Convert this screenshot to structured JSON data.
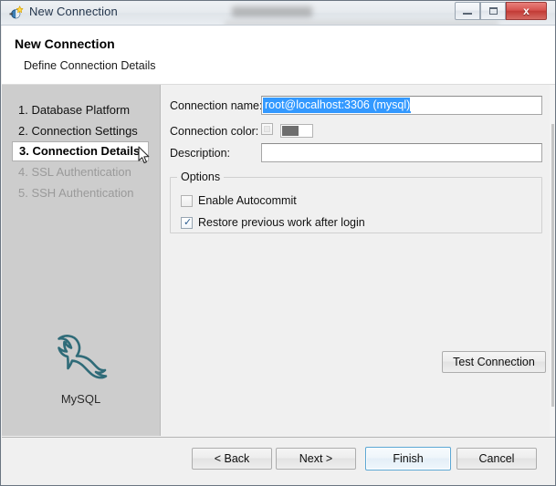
{
  "window": {
    "title": "New Connection",
    "icon": "connection-plug-icon",
    "controls": {
      "minimize": "Minimize",
      "maximize": "Maximize",
      "close": "Close",
      "close_glyph": "x"
    }
  },
  "header": {
    "title": "New Connection",
    "subtitle": "Define Connection Details"
  },
  "sidebar": {
    "steps": [
      {
        "label": "1. Database Platform",
        "state": "done"
      },
      {
        "label": "2. Connection Settings",
        "state": "done"
      },
      {
        "label": "3. Connection Details",
        "state": "active"
      },
      {
        "label": "4. SSL Authentication",
        "state": "disabled"
      },
      {
        "label": "5. SSH Authentication",
        "state": "disabled"
      }
    ],
    "product": {
      "name": "MySQL",
      "logo": "mysql-dolphin-logo",
      "logo_color": "#2f6b78"
    }
  },
  "form": {
    "connection_name": {
      "label": "Connection name:",
      "value": "root@localhost:3306 (mysql)",
      "placeholder": "",
      "selected": true,
      "selection_color": "#3399ff"
    },
    "connection_color": {
      "label": "Connection color:",
      "enabled": false,
      "swatch_color": "#6e6e6e"
    },
    "description": {
      "label": "Description:",
      "value": "",
      "placeholder": ""
    }
  },
  "options": {
    "legend": "Options",
    "items": [
      {
        "label": "Enable Autocommit",
        "checked": false
      },
      {
        "label": "Restore previous work after login",
        "checked": true,
        "tick": "✓"
      }
    ]
  },
  "actions": {
    "test_connection": "Test Connection",
    "back": "< Back",
    "next": "Next >",
    "finish": "Finish",
    "cancel": "Cancel",
    "default_button": "Finish"
  }
}
